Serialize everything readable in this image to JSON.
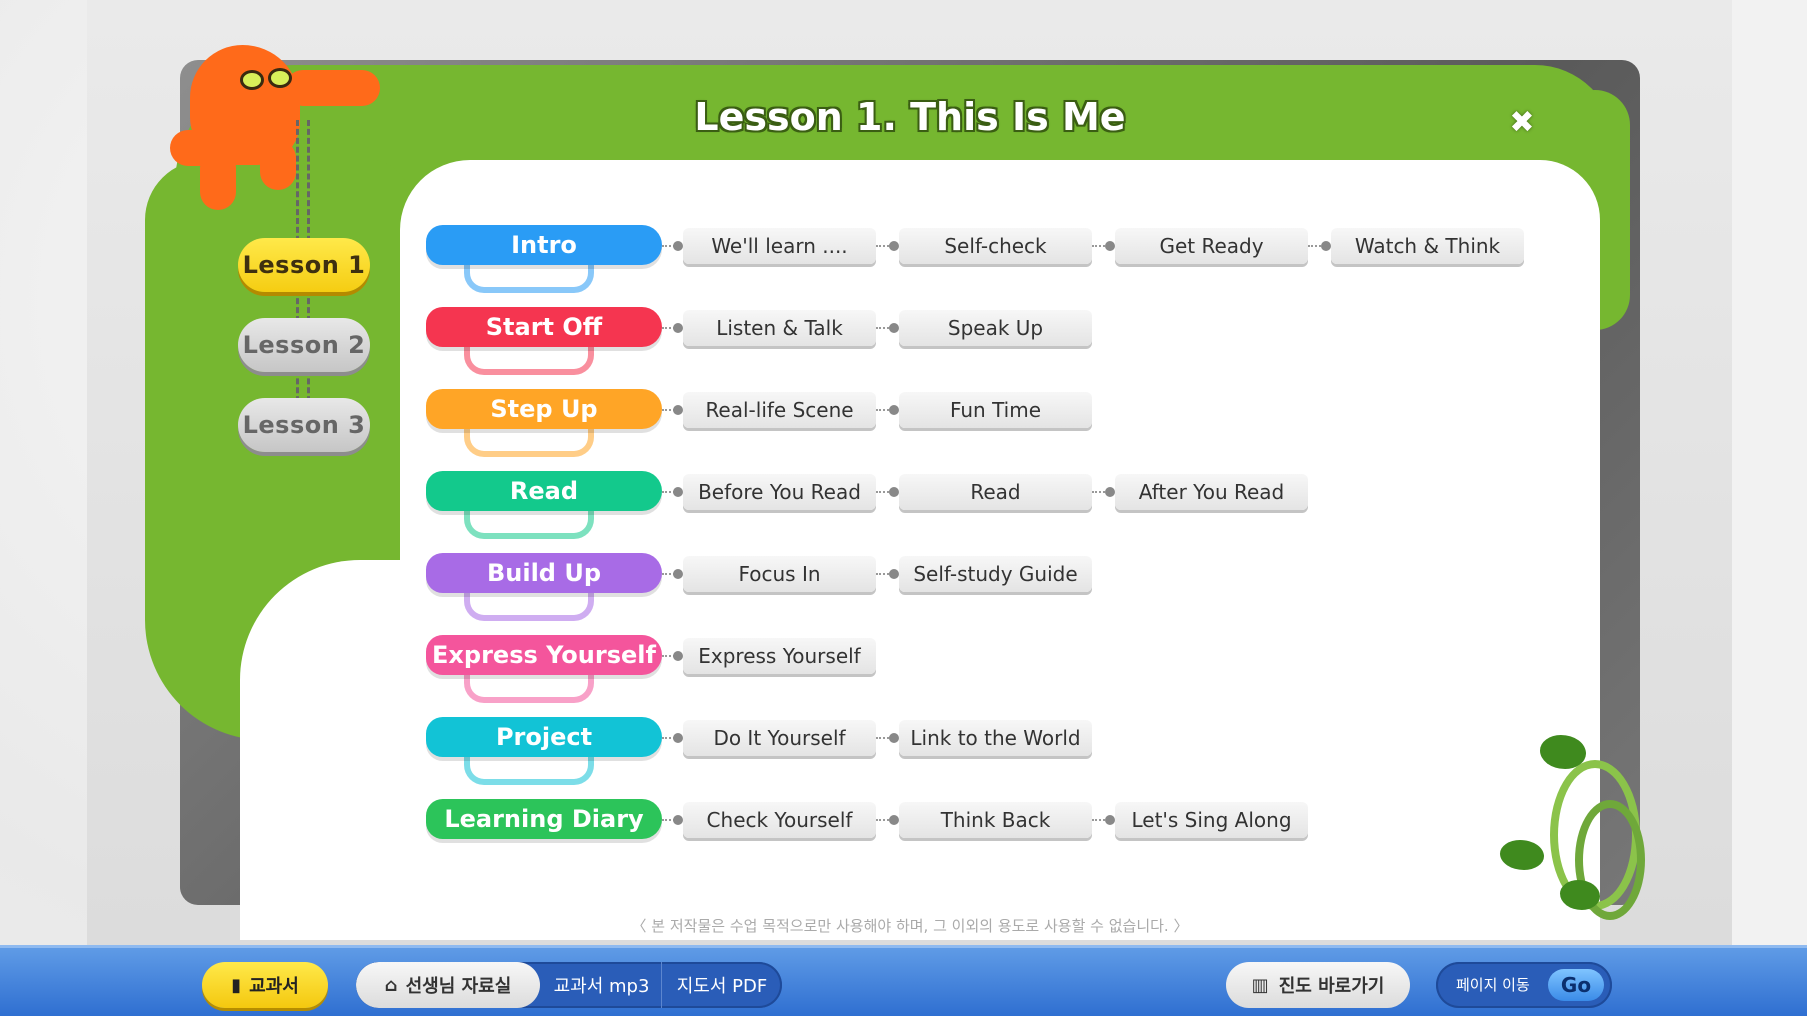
{
  "title": "Lesson 1. This Is Me",
  "close_icon": "close-icon",
  "lessons": [
    {
      "label": "Lesson 1",
      "active": true
    },
    {
      "label": "Lesson 2",
      "active": false
    },
    {
      "label": "Lesson 3",
      "active": false
    }
  ],
  "sections": [
    {
      "label": "Intro",
      "color": "#2a9cf5",
      "items": [
        "We'll learn ....",
        "Self-check",
        "Get Ready",
        "Watch & Think"
      ]
    },
    {
      "label": "Start Off",
      "color": "#f53550",
      "items": [
        "Listen & Talk",
        "Speak Up"
      ]
    },
    {
      "label": "Step Up",
      "color": "#ffa526",
      "items": [
        "Real-life Scene",
        "Fun Time"
      ]
    },
    {
      "label": "Read",
      "color": "#13c98c",
      "items": [
        "Before You Read",
        "Read",
        "After You Read"
      ]
    },
    {
      "label": "Build Up",
      "color": "#a86be6",
      "items": [
        "Focus In",
        "Self-study Guide"
      ]
    },
    {
      "label": "Express Yourself",
      "color": "#f4559c",
      "items": [
        "Express Yourself"
      ]
    },
    {
      "label": "Project",
      "color": "#12c3d6",
      "items": [
        "Do It Yourself",
        "Link to the World"
      ]
    },
    {
      "label": "Learning Diary",
      "color": "#2cc45a",
      "items": [
        "Check Yourself",
        "Think Back",
        "Let's Sing Along"
      ]
    }
  ],
  "notice": "〈 본 저작물은 수업 목적으로만 사용해야 하며, 그 이외의 용도로 사용할 수 없습니다. 〉",
  "bottombar": {
    "textbook": "교과서",
    "teacher_materials": "선생님 자료실",
    "mp3": "교과서 mp3",
    "pdf": "지도서 PDF",
    "progress": "진도 바로가기",
    "page_move": "페이지 이동",
    "go": "Go"
  }
}
